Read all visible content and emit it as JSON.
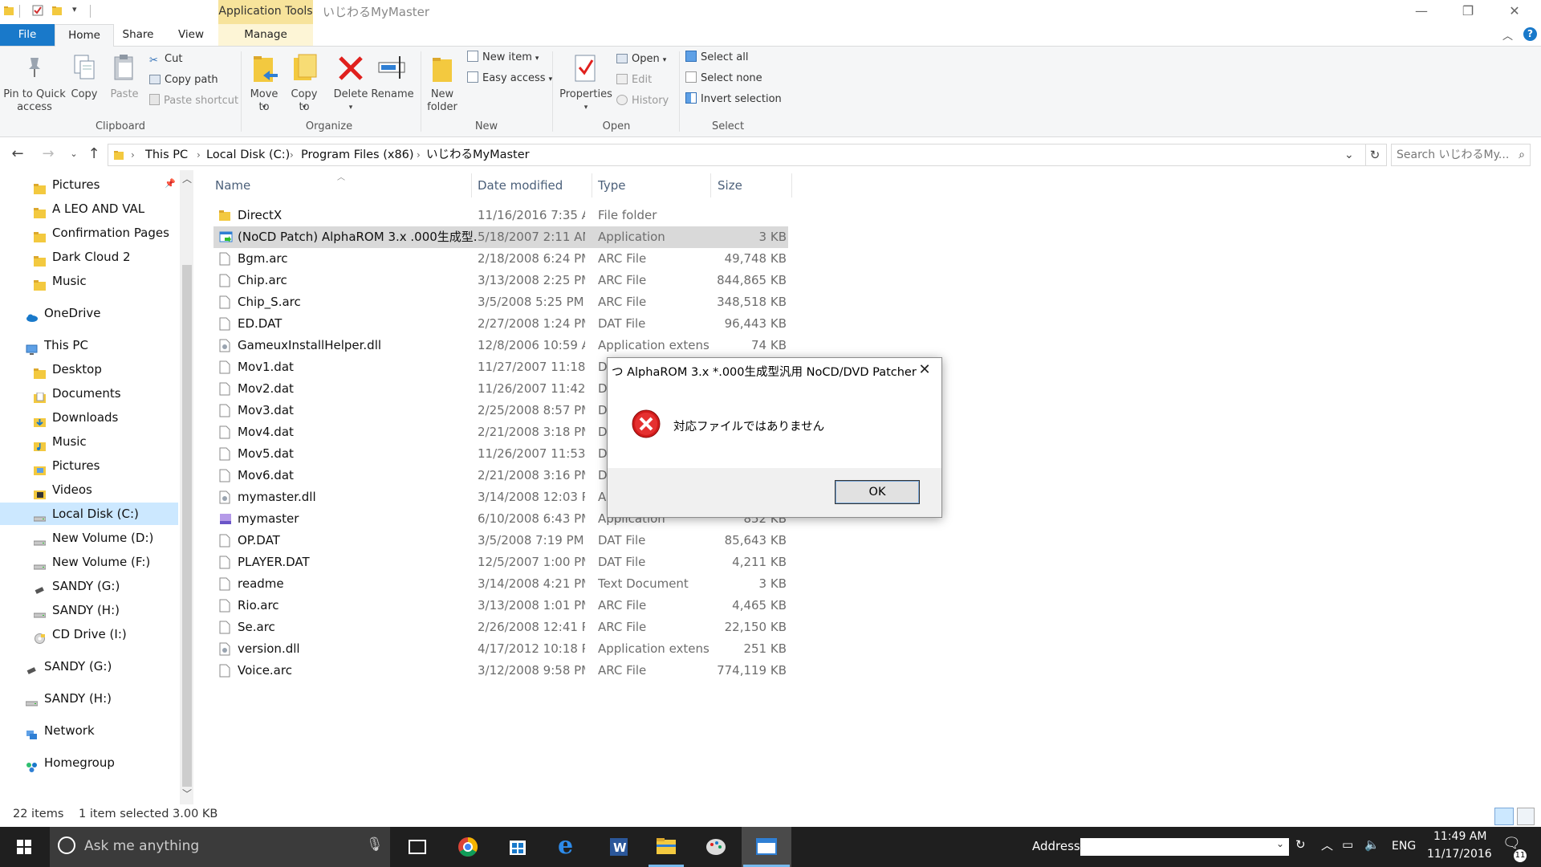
{
  "window": {
    "title": "いじわるMyMaster",
    "contextual_tab_group": "Application Tools",
    "controls": {
      "minimize": "—",
      "restore": "❐",
      "close": "✕"
    }
  },
  "ribbon": {
    "tabs": [
      "File",
      "Home",
      "Share",
      "View",
      "Manage"
    ],
    "active_tab": "Home",
    "clipboard": {
      "pin": "Pin to Quick access",
      "copy": "Copy",
      "paste": "Paste",
      "cut": "Cut",
      "copy_path": "Copy path",
      "paste_shortcut": "Paste shortcut",
      "group": "Clipboard"
    },
    "organize": {
      "move_to": "Move to",
      "copy_to": "Copy to",
      "delete": "Delete",
      "rename": "Rename",
      "group": "Organize"
    },
    "new": {
      "new_folder": "New folder",
      "new_item": "New item",
      "easy_access": "Easy access",
      "group": "New"
    },
    "open": {
      "properties": "Properties",
      "open": "Open",
      "edit": "Edit",
      "history": "History",
      "group": "Open"
    },
    "select": {
      "select_all": "Select all",
      "select_none": "Select none",
      "invert_selection": "Invert selection",
      "group": "Select"
    }
  },
  "address": {
    "breadcrumbs": [
      "This PC",
      "Local Disk (C:)",
      "Program Files (x86)",
      "いじわるMyMaster"
    ],
    "search_placeholder": "Search いじわるMy..."
  },
  "nav_pane": [
    {
      "label": "Pictures",
      "icon": "folder-icon",
      "indent": 1
    },
    {
      "label": "A LEO AND VAL",
      "icon": "folder-icon",
      "indent": 1
    },
    {
      "label": "Confirmation Pages",
      "icon": "folder-icon",
      "indent": 1
    },
    {
      "label": "Dark Cloud 2",
      "icon": "folder-icon",
      "indent": 1
    },
    {
      "label": "Music",
      "icon": "folder-icon",
      "indent": 1
    },
    {
      "label": "OneDrive",
      "icon": "cloud-icon",
      "indent": 0
    },
    {
      "label": "This PC",
      "icon": "computer-icon",
      "indent": 0
    },
    {
      "label": "Desktop",
      "icon": "folder-icon",
      "indent": 1
    },
    {
      "label": "Documents",
      "icon": "documents-icon",
      "indent": 1
    },
    {
      "label": "Downloads",
      "icon": "downloads-icon",
      "indent": 1
    },
    {
      "label": "Music",
      "icon": "music-icon",
      "indent": 1
    },
    {
      "label": "Pictures",
      "icon": "pictures-icon",
      "indent": 1
    },
    {
      "label": "Videos",
      "icon": "videos-icon",
      "indent": 1
    },
    {
      "label": "Local Disk (C:)",
      "icon": "drive-icon",
      "indent": 1,
      "selected": true
    },
    {
      "label": "New Volume (D:)",
      "icon": "drive-icon",
      "indent": 1
    },
    {
      "label": "New Volume (F:)",
      "icon": "drive-icon",
      "indent": 1
    },
    {
      "label": "SANDY (G:)",
      "icon": "usb-icon",
      "indent": 1
    },
    {
      "label": "SANDY (H:)",
      "icon": "drive-icon",
      "indent": 1
    },
    {
      "label": "CD Drive (I:)",
      "icon": "cd-icon",
      "indent": 1
    },
    {
      "label": "SANDY (G:)",
      "icon": "usb-icon",
      "indent": 0
    },
    {
      "label": "SANDY (H:)",
      "icon": "drive-icon",
      "indent": 0
    },
    {
      "label": "Network",
      "icon": "network-icon",
      "indent": 0
    },
    {
      "label": "Homegroup",
      "icon": "homegroup-icon",
      "indent": 0
    }
  ],
  "columns": {
    "name": "Name",
    "date": "Date modified",
    "type": "Type",
    "size": "Size"
  },
  "files": [
    {
      "name": "DirectX",
      "date": "11/16/2016 7:35 A...",
      "type": "File folder",
      "size": "",
      "icon": "folder"
    },
    {
      "name": "(NoCD Patch) AlphaROM 3.x .000生成型...",
      "date": "5/18/2007 2:11 AM",
      "type": "Application",
      "size": "3 KB",
      "icon": "app",
      "selected": true
    },
    {
      "name": "Bgm.arc",
      "date": "2/18/2008 6:24 PM",
      "type": "ARC File",
      "size": "49,748 KB",
      "icon": "file"
    },
    {
      "name": "Chip.arc",
      "date": "3/13/2008 2:25 PM",
      "type": "ARC File",
      "size": "844,865 KB",
      "icon": "file"
    },
    {
      "name": "Chip_S.arc",
      "date": "3/5/2008 5:25 PM",
      "type": "ARC File",
      "size": "348,518 KB",
      "icon": "file"
    },
    {
      "name": "ED.DAT",
      "date": "2/27/2008 1:24 PM",
      "type": "DAT File",
      "size": "96,443 KB",
      "icon": "file"
    },
    {
      "name": "GameuxInstallHelper.dll",
      "date": "12/8/2006 10:59 A...",
      "type": "Application extens...",
      "size": "74 KB",
      "icon": "dll"
    },
    {
      "name": "Mov1.dat",
      "date": "11/27/2007 11:18 ...",
      "type": "D",
      "size": "",
      "icon": "file"
    },
    {
      "name": "Mov2.dat",
      "date": "11/26/2007 11:42 ...",
      "type": "D",
      "size": "",
      "icon": "file"
    },
    {
      "name": "Mov3.dat",
      "date": "2/25/2008 8:57 PM",
      "type": "D",
      "size": "",
      "icon": "file"
    },
    {
      "name": "Mov4.dat",
      "date": "2/21/2008 3:18 PM",
      "type": "D",
      "size": "",
      "icon": "file"
    },
    {
      "name": "Mov5.dat",
      "date": "11/26/2007 11:53 ...",
      "type": "D",
      "size": "",
      "icon": "file"
    },
    {
      "name": "Mov6.dat",
      "date": "2/21/2008 3:16 PM",
      "type": "D",
      "size": "",
      "icon": "file"
    },
    {
      "name": "mymaster.dll",
      "date": "3/14/2008 12:03 PM",
      "type": "A",
      "size": "",
      "icon": "dll"
    },
    {
      "name": "mymaster",
      "date": "6/10/2008 6:43 PM",
      "type": "Application",
      "size": "852 KB",
      "icon": "app2"
    },
    {
      "name": "OP.DAT",
      "date": "3/5/2008 7:19 PM",
      "type": "DAT File",
      "size": "85,643 KB",
      "icon": "file"
    },
    {
      "name": "PLAYER.DAT",
      "date": "12/5/2007 1:00 PM",
      "type": "DAT File",
      "size": "4,211 KB",
      "icon": "file"
    },
    {
      "name": "readme",
      "date": "3/14/2008 4:21 PM",
      "type": "Text Document",
      "size": "3 KB",
      "icon": "file"
    },
    {
      "name": "Rio.arc",
      "date": "3/13/2008 1:01 PM",
      "type": "ARC File",
      "size": "4,465 KB",
      "icon": "file"
    },
    {
      "name": "Se.arc",
      "date": "2/26/2008 12:41 PM",
      "type": "ARC File",
      "size": "22,150 KB",
      "icon": "file"
    },
    {
      "name": "version.dll",
      "date": "4/17/2012 10:18 PM",
      "type": "Application extens...",
      "size": "251 KB",
      "icon": "dll"
    },
    {
      "name": "Voice.arc",
      "date": "3/12/2008 9:58 PM",
      "type": "ARC File",
      "size": "774,119 KB",
      "icon": "file"
    }
  ],
  "status": {
    "items": "22 items",
    "selection": "1 item selected  3.00 KB"
  },
  "dialog": {
    "title": "つ AlphaROM 3.x *.000生成型汎用 NoCD/DVD Patcher",
    "message": "対応ファイルではありません",
    "ok": "OK",
    "close": "✕"
  },
  "taskbar": {
    "search_placeholder": "Ask me anything",
    "address_label": "Address",
    "language": "ENG",
    "time": "11:49 AM",
    "date": "11/17/2016",
    "notifications": "11"
  },
  "colors": {
    "accent": "#1979ca",
    "selected_row": "#d9d9d9",
    "nav_selected": "#cce8ff",
    "folder": "#f3c93f",
    "taskbar": "#1f1f1f"
  }
}
